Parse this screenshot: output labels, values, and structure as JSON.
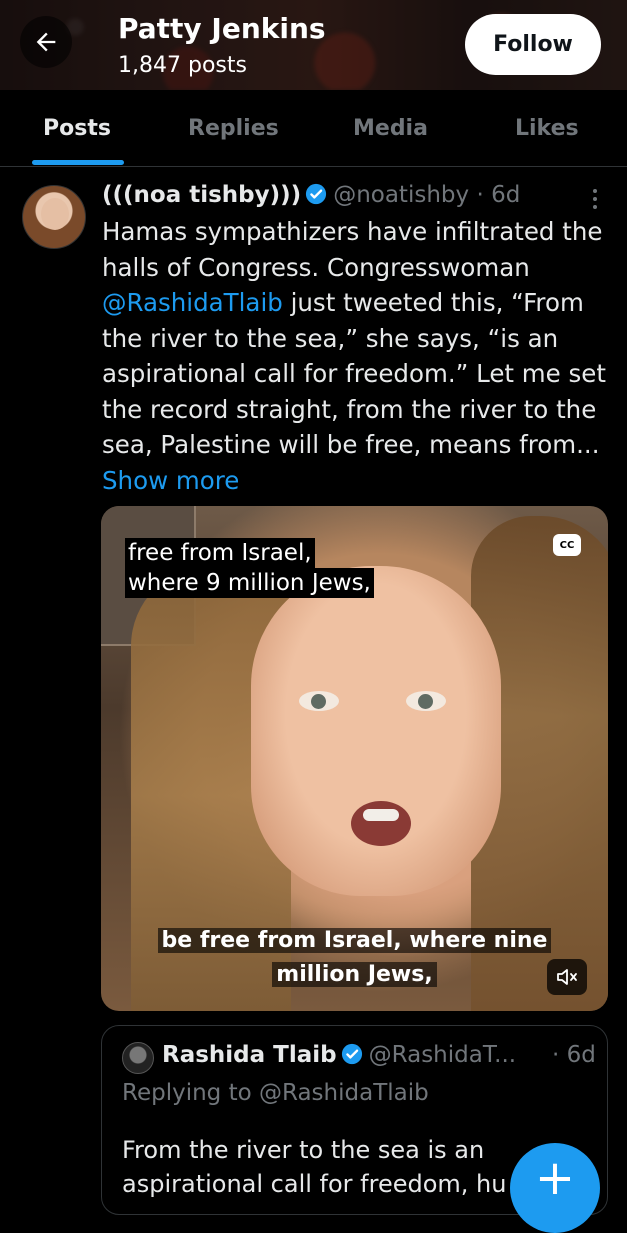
{
  "header": {
    "profile_name": "Patty Jenkins",
    "post_count": "1,847 posts",
    "follow_label": "Follow",
    "back_icon": "arrow-left-icon"
  },
  "tabs": [
    {
      "label": "Posts",
      "active": true
    },
    {
      "label": "Replies",
      "active": false
    },
    {
      "label": "Media",
      "active": false
    },
    {
      "label": "Likes",
      "active": false
    }
  ],
  "tweet": {
    "author_name": "(((noa tishby)))",
    "handle": "@noatishby",
    "separator": "·",
    "time": "6d",
    "text_lines": [
      "Hamas sympathizers have infiltrated the",
      "halls of Congress. Congresswoman",
      " just tweeted this, “From",
      "the river to the sea,” she says, “is an",
      "aspirational call for freedom.” Let me set",
      "the record straight, from the river to the",
      "sea, Palestine will be free, means from..."
    ],
    "mention": "@RashidaTlaib",
    "show_more": "Show more"
  },
  "video": {
    "caption_top_lines": [
      "free from Israel,",
      "where 9 million Jews,"
    ],
    "cc_label": "CC",
    "caption_bottom_lines": [
      "be free from Israel, where nine",
      "million Jews,"
    ]
  },
  "quote": {
    "author_name": "Rashida Tlaib",
    "handle": "@RashidaT...",
    "time": "· 6d",
    "replying_to": "Replying to @RashidaTlaib",
    "text_lines": [
      "From the river to the sea is an",
      "aspirational call for freedom, hu"
    ]
  },
  "fab_label": "+",
  "colors": {
    "accent": "#1d9bf0",
    "muted": "#71767b",
    "text": "#e7e9ea",
    "background": "#000000"
  }
}
